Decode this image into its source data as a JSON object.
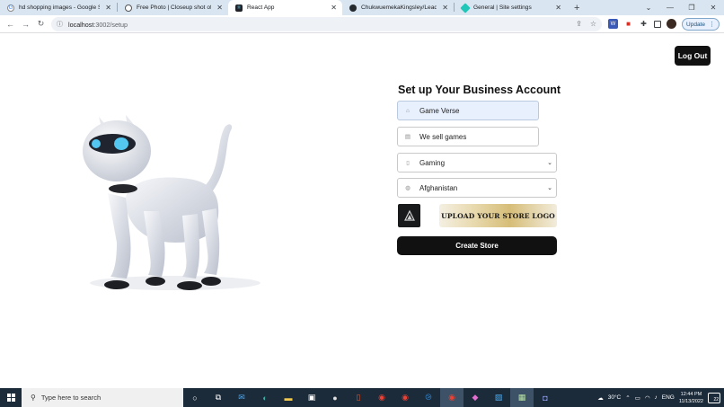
{
  "browser": {
    "tabs": [
      {
        "title": "hd shopping images - Google Se",
        "favicon": "google-icon",
        "active": false
      },
      {
        "title": "Free Photo | Closeup shot of tw",
        "favicon": "freepik-icon",
        "active": false
      },
      {
        "title": "React App",
        "favicon": "react-icon",
        "active": true
      },
      {
        "title": "ChukwuemekaKingsley/LeadingE",
        "favicon": "github-icon",
        "active": false
      },
      {
        "title": "General | Site settings",
        "favicon": "netlify-icon",
        "active": false
      }
    ],
    "url_host": "localhost",
    "url_rest": ":3002/setup",
    "update_label": "Update"
  },
  "page": {
    "logout_label": "Log Out",
    "form_title": "Set up Your Business Account",
    "business_name_value": "Game Verse",
    "description_value": "We sell games",
    "category_selected": "Gaming",
    "country_selected": "Afghanistan",
    "upload_label": "UPLOAD YOUR STORE LOGO",
    "create_label": "Create Store"
  },
  "taskbar": {
    "search_placeholder": "Type here to search",
    "weather": "30°C",
    "language": "ENG",
    "time": "12:44 PM",
    "date": "11/13/2022",
    "notification_count": "22"
  },
  "colors": {
    "tab_strip": "#d9e5f1",
    "button_dark": "#111111",
    "taskbar": "#1c2b3a",
    "upload_gold": "#d6bd78"
  }
}
